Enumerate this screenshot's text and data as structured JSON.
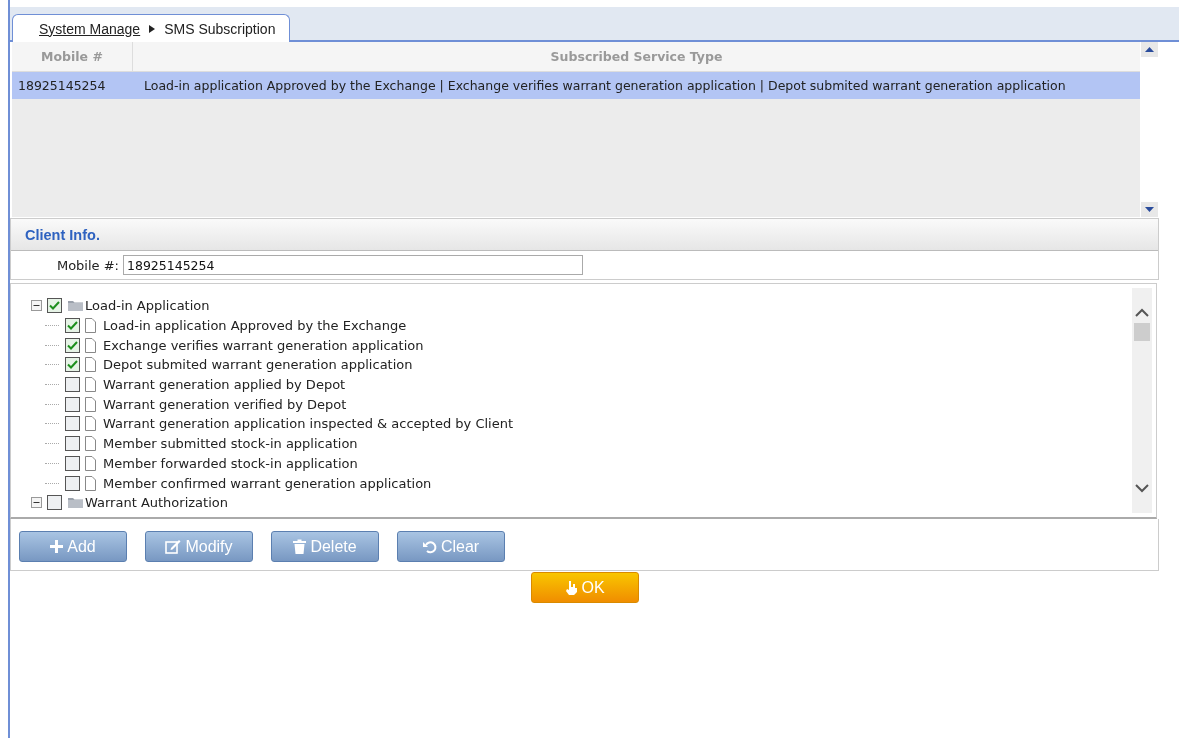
{
  "breadcrumb": {
    "items": [
      "System Manage",
      "SMS Subscription"
    ]
  },
  "table": {
    "columns": [
      "Mobile #",
      "Subscribed Service Type"
    ],
    "rows": [
      {
        "cells": [
          "18925145254",
          "Load-in application Approved by the Exchange | Exchange verifies warrant generation application | Depot submited warrant generation application"
        ],
        "selected": true
      }
    ]
  },
  "client_info": {
    "title": "Client Info.",
    "mobile_label": "Mobile #:",
    "mobile_value": "18925145254"
  },
  "tree": [
    {
      "label": "Load-in Application",
      "checked": true,
      "expanded": true,
      "children": [
        {
          "label": "Load-in application Approved by the Exchange",
          "checked": true
        },
        {
          "label": "Exchange verifies warrant generation application",
          "checked": true
        },
        {
          "label": "Depot submited warrant generation application",
          "checked": true
        },
        {
          "label": "Warrant generation applied by Depot",
          "checked": false
        },
        {
          "label": "Warrant generation verified by Depot",
          "checked": false
        },
        {
          "label": "Warrant generation application inspected & accepted by Client",
          "checked": false
        },
        {
          "label": "Member submitted stock-in application",
          "checked": false
        },
        {
          "label": "Member forwarded stock-in application",
          "checked": false
        },
        {
          "label": "Member confirmed warrant generation application",
          "checked": false
        }
      ]
    },
    {
      "label": "Warrant Authorization",
      "checked": false,
      "expanded": true
    }
  ],
  "buttons": [
    {
      "kind": "add",
      "label": "Add"
    },
    {
      "kind": "modify",
      "label": "Modify"
    },
    {
      "kind": "delete",
      "label": "Delete"
    },
    {
      "kind": "clear",
      "label": "Clear"
    }
  ],
  "ok_button": {
    "label": "OK"
  }
}
